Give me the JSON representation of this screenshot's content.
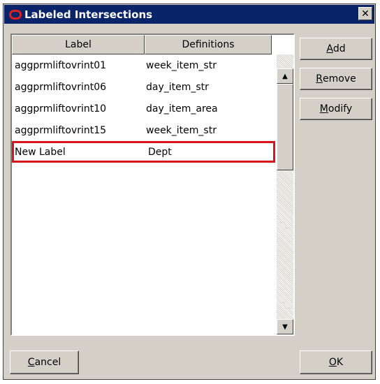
{
  "window": {
    "title": "Labeled Intersections",
    "close_glyph": "✕"
  },
  "grid": {
    "columns": [
      "Label",
      "Definitions"
    ],
    "rows": [
      {
        "label": "aggprmliftovrint01",
        "definition": "week_item_str"
      },
      {
        "label": "aggprmliftovrint06",
        "definition": "day_item_str"
      },
      {
        "label": "aggprmliftovrint10",
        "definition": "day_item_area"
      },
      {
        "label": "aggprmliftovrint15",
        "definition": "week_item_str"
      },
      {
        "label": "New Label",
        "definition": "Dept",
        "selected": true
      }
    ],
    "scroll_up_glyph": "▲",
    "scroll_down_glyph": "▼"
  },
  "buttons": {
    "add": {
      "mnemonic": "A",
      "rest": "dd"
    },
    "remove": {
      "mnemonic": "R",
      "rest": "emove"
    },
    "modify": {
      "mnemonic": "M",
      "rest": "odify"
    },
    "cancel": {
      "mnemonic": "C",
      "rest": "ancel"
    },
    "ok": {
      "mnemonic": "O",
      "rest": "K"
    }
  },
  "colors": {
    "titlebar": "#0a246a",
    "dialog_face": "#d4d0c8",
    "selection_border": "#d9141b",
    "title_icon": "#e02020"
  }
}
